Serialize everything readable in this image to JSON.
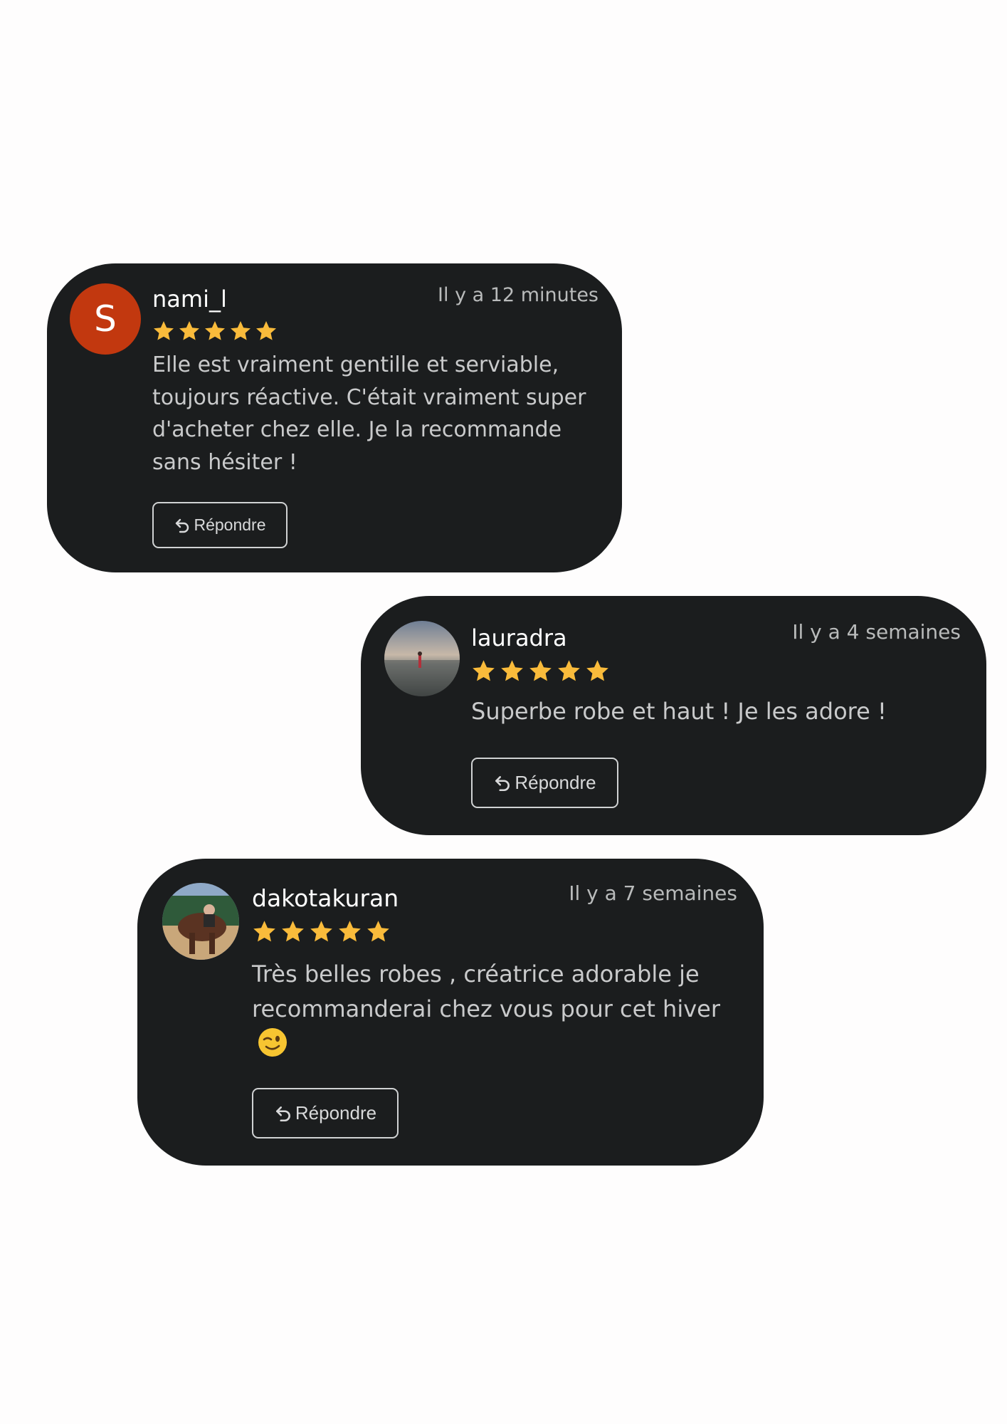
{
  "reviews": [
    {
      "username": "nami_l",
      "avatar_initial": "S",
      "time": "Il y a 12 minutes",
      "rating": 5,
      "text": "Elle est vraiment gentille et serviable, toujours réactive. C'était vraiment super d'acheter chez elle. Je la recommande sans hésiter !",
      "reply_label": "Répondre"
    },
    {
      "username": "lauradra",
      "time": "Il y a 4 semaines",
      "rating": 5,
      "text": "Superbe robe et haut ! Je les adore !",
      "reply_label": "Répondre"
    },
    {
      "username": "dakotakuran",
      "time": "Il y a 7 semaines",
      "rating": 5,
      "text": "Très belles robes , créatrice adorable je recommanderai chez vous pour cet hiver",
      "reply_label": "Répondre"
    }
  ],
  "colors": {
    "card_background": "#1b1d1e",
    "page_background": "#fefdfd",
    "star": "#f9bb3b",
    "avatar_initial_bg": "#c2380f"
  },
  "icons": {
    "star": "star-icon",
    "reply": "reply-arrow-icon",
    "emoji": "winking-face-emoji"
  }
}
